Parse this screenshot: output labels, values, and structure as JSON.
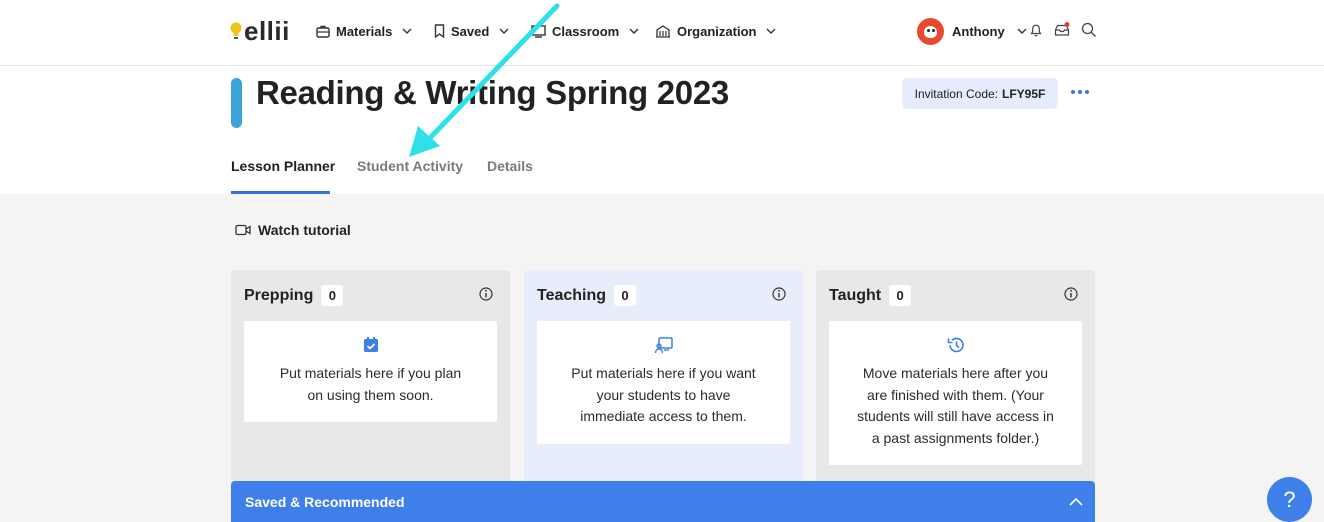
{
  "brand": {
    "logo_text": "ellii",
    "accent": "#3f7fea",
    "bulb_color": "#f4c21b"
  },
  "nav": {
    "items": [
      {
        "label": "Materials",
        "icon": "briefcase-icon"
      },
      {
        "label": "Saved",
        "icon": "bookmark-icon"
      },
      {
        "label": "Classroom",
        "icon": "chalkboard-icon"
      },
      {
        "label": "Organization",
        "icon": "building-icon"
      }
    ],
    "user_name": "Anthony"
  },
  "header": {
    "title": "Reading & Writing Spring 2023",
    "invite_label": "Invitation Code:",
    "invite_code": "LFY95F"
  },
  "tabs": [
    {
      "label": "Lesson Planner",
      "active": true
    },
    {
      "label": "Student Activity",
      "active": false
    },
    {
      "label": "Details",
      "active": false
    }
  ],
  "tutorial": {
    "label": "Watch tutorial"
  },
  "columns": [
    {
      "title": "Prepping",
      "count": "0",
      "icon": "calendar-check-icon",
      "lines": [
        "Put materials here if you plan",
        "on using them soon."
      ]
    },
    {
      "title": "Teaching",
      "count": "0",
      "icon": "presentation-icon",
      "lines": [
        "Put materials here if you want",
        "your students to have",
        "immediate access to them."
      ]
    },
    {
      "title": "Taught",
      "count": "0",
      "icon": "history-icon",
      "lines": [
        "Move materials here after you",
        "are finished with them. (Your",
        "students will still have access in",
        "a past assignments folder.)"
      ]
    }
  ],
  "saved_bar": {
    "label": "Saved & Recommended"
  },
  "help": {
    "label": "?"
  },
  "annotation": {
    "arrow_color": "#2ee0e8"
  }
}
